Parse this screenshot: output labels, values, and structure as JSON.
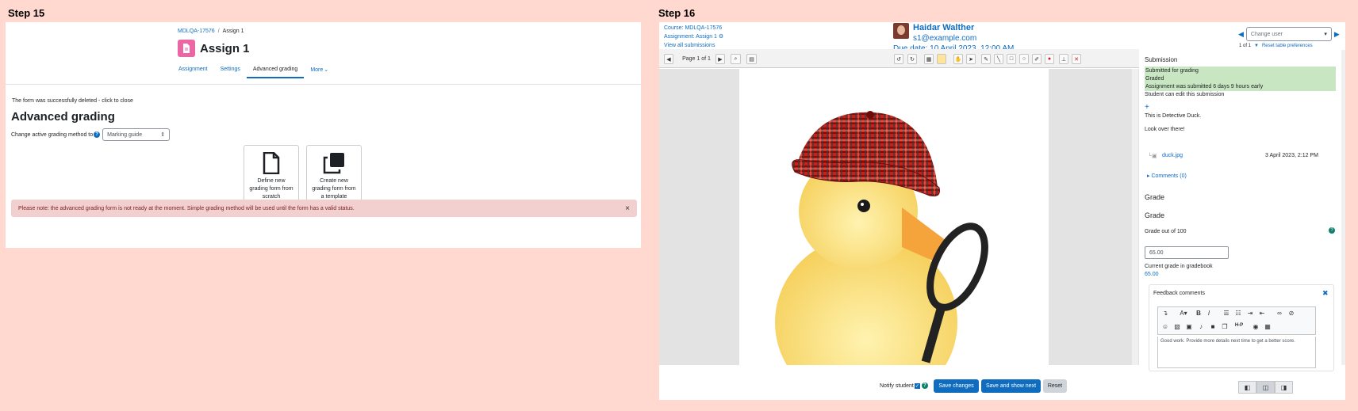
{
  "step15": {
    "label": "Step 15",
    "breadcrumb": [
      "MDLQA-17576",
      "Assign 1"
    ],
    "title": "Assign 1",
    "tabs": [
      "Assignment",
      "Settings",
      "Advanced grading",
      "More"
    ],
    "notice": "The form was successfully deleted - click to close",
    "heading": "Advanced grading",
    "method_label": "Change active grading method to",
    "method_value": "Marking guide",
    "cards": [
      {
        "line1": "Define new",
        "line2": "grading form from",
        "line3": "scratch"
      },
      {
        "line1": "Create new",
        "line2": "grading form from",
        "line3": "a template"
      }
    ],
    "alert": "Please note: the advanced grading form is not ready at the moment. Simple grading method will be used until the form has a valid status.",
    "alert_close": "×"
  },
  "step16": {
    "label": "Step 16",
    "header": {
      "course": "Course: MDLQA-17576",
      "assignment": "Assignment: Assign 1",
      "view_all": "View all submissions",
      "user_name": "Haidar Walther",
      "user_email": "s1@example.com",
      "due_date": "Due date: 10 April 2023, 12:00 AM",
      "change_user_placeholder": "Change user",
      "counter": "1 of 1",
      "reset_prefs": "Reset table preferences"
    },
    "toolbar": {
      "page_label": "Page 1 of 1"
    },
    "submission": {
      "title": "Submission",
      "status_lines": [
        "Submitted for grading",
        "Graded",
        "Assignment was submitted 6 days 9 hours early"
      ],
      "can_edit": "Student can edit this submission",
      "plus": "+",
      "text1": "This is Detective Duck.",
      "text2": "Look over there!",
      "file_name": "duck.jpg",
      "file_date": "3 April 2023, 2:12 PM",
      "comments": "Comments (0)"
    },
    "grade": {
      "heading1": "Grade",
      "heading2": "Grade",
      "out_of": "Grade out of 100",
      "value": "65.00",
      "gradebook_label": "Current grade in gradebook",
      "gradebook_value": "65.00"
    },
    "feedback": {
      "title": "Feedback comments",
      "text": "Good work. Provide more details next time to get a better score."
    },
    "footer": {
      "notify": "Notify student",
      "save": "Save changes",
      "save_next": "Save and show next",
      "reset": "Reset"
    }
  }
}
